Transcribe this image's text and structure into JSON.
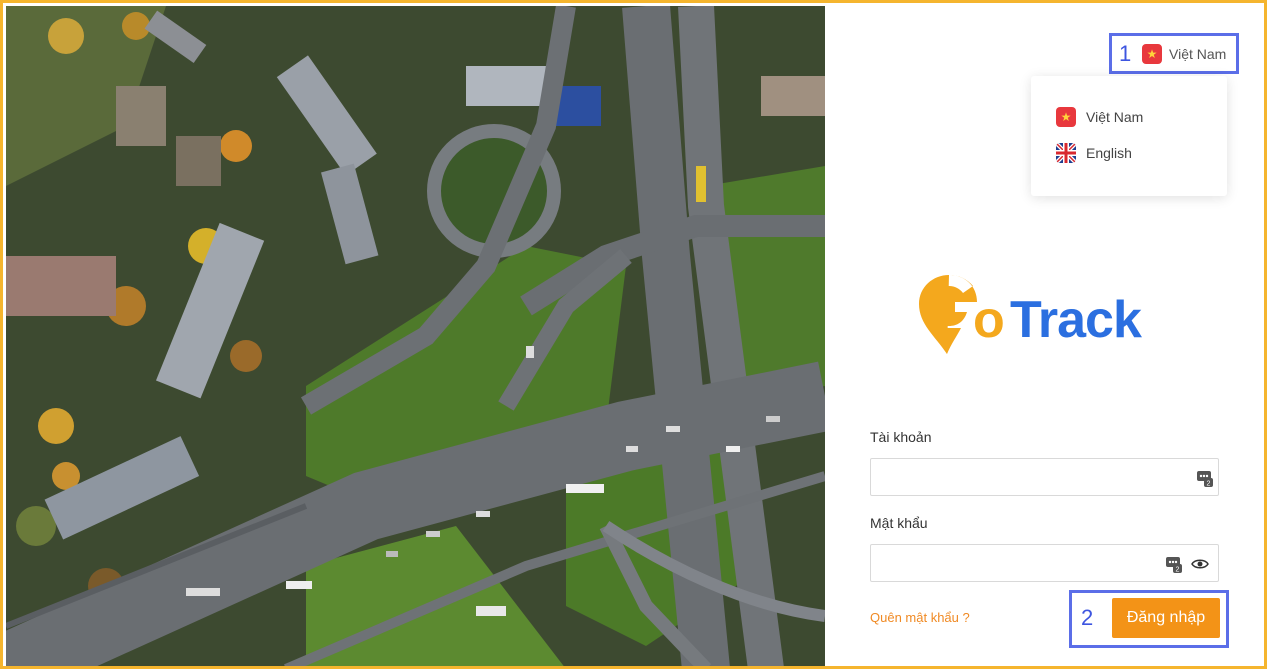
{
  "language": {
    "current_label": "Việt Nam",
    "options": [
      {
        "label": "Việt Nam",
        "flag": "vietnam-flag-icon"
      },
      {
        "label": "English",
        "flag": "uk-flag-icon"
      }
    ]
  },
  "annotations": {
    "marker_1": "1",
    "marker_2": "2",
    "color": "#5b6ee8"
  },
  "brand": {
    "logo_text_go": "Go",
    "logo_text_track": "Track",
    "primary_color": "#f39317",
    "secondary_color": "#2b6fe0"
  },
  "form": {
    "username_label": "Tài khoản",
    "username_value": "",
    "password_label": "Mật khẩu",
    "password_value": "",
    "forgot_link": "Quên mật khẩu ?",
    "login_button": "Đăng nhập"
  }
}
